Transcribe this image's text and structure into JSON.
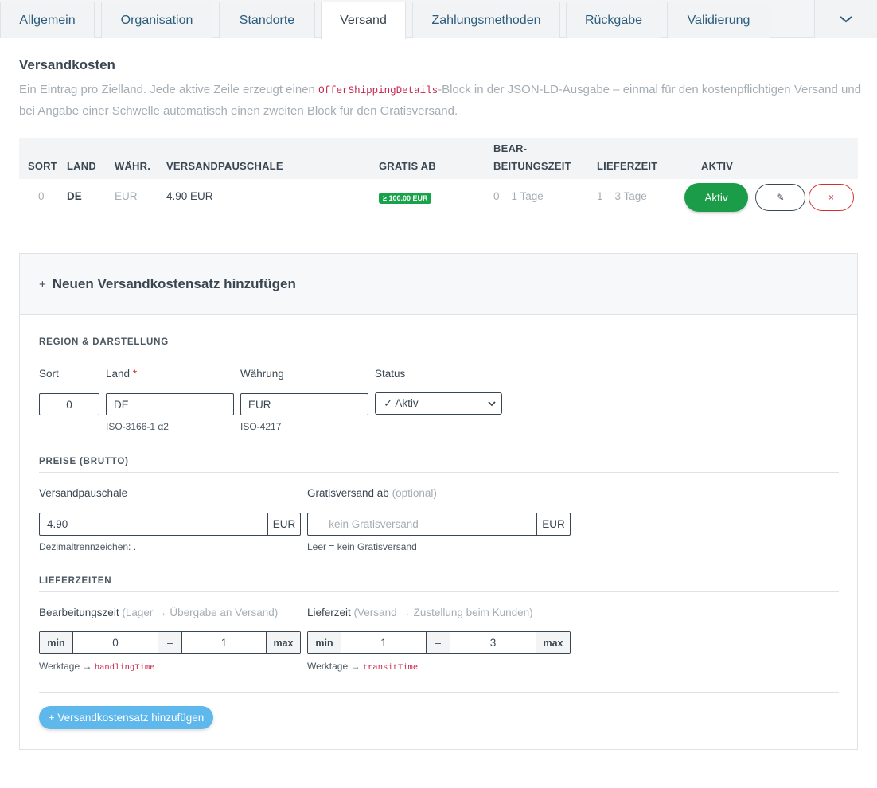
{
  "tabs": [
    {
      "label": "Allgemein"
    },
    {
      "label": "Organisation"
    },
    {
      "label": "Standorte"
    },
    {
      "label": "Versand"
    },
    {
      "label": "Zahlungsmethoden"
    },
    {
      "label": "Rückgabe"
    },
    {
      "label": "Validierung"
    }
  ],
  "active_tab": "Versand",
  "section": {
    "title": "Versandkosten",
    "intro_before": "Ein Eintrag pro Zielland. Jede aktive Zeile erzeugt einen ",
    "intro_code": "OfferShippingDetails",
    "intro_after": "-Block in der JSON-LD-Ausgabe – einmal für den kostenpflichtigen Versand und bei Angabe einer Schwelle automatisch einen zweiten Block für den Gratisversand."
  },
  "table": {
    "headers": {
      "sort": "SORT",
      "land": "LAND",
      "waehr": "WÄHR.",
      "pauschale": "VERSANDPAUSCHALE",
      "gratis": "GRATIS AB",
      "bearbeitung_1": "BEAR-",
      "bearbeitung_2": "BEITUNGSZEIT",
      "lieferzeit": "LIEFERZEIT",
      "aktiv": "AKTIV"
    },
    "rows": [
      {
        "sort": "0",
        "land": "DE",
        "waehrung": "EUR",
        "pauschale": "4.90 EUR",
        "gratis_badge": "≥ 100.00 EUR",
        "bearbeitung": "0 – 1 Tage",
        "lieferzeit": "1 – 3 Tage",
        "aktiv_label": "Aktiv",
        "edit_icon": "✎",
        "delete_icon": "×"
      }
    ]
  },
  "form": {
    "header_plus": "+",
    "header_title": "Neuen Versandkostensatz hinzufügen",
    "region": {
      "title": "REGION & DARSTELLUNG",
      "sort_label": "Sort",
      "sort_value": "0",
      "land_label": "Land",
      "land_required": "*",
      "land_value": "DE",
      "land_help": "ISO-3166-1 α2",
      "waehrung_label": "Währung",
      "waehrung_value": "EUR",
      "waehrung_help": "ISO-4217",
      "status_label": "Status",
      "status_value": "✓ Aktiv"
    },
    "preise": {
      "title": "PREISE (BRUTTO)",
      "pauschale_label": "Versandpauschale",
      "pauschale_value": "4.90",
      "pauschale_unit": "EUR",
      "pauschale_help": "Dezimaltrennzeichen: .",
      "gratis_label": "Gratisversand ab",
      "gratis_optional": "(optional)",
      "gratis_placeholder": "— kein Gratisversand —",
      "gratis_unit": "EUR",
      "gratis_help": "Leer = kein Gratisversand"
    },
    "lieferzeiten": {
      "title": "LIEFERZEITEN",
      "bearbeitung_label": "Bearbeitungszeit",
      "bearbeitung_hint": "(Lager → Übergabe an Versand)",
      "bearbeitung_min_label": "min",
      "bearbeitung_min": "0",
      "bearbeitung_sep": "–",
      "bearbeitung_max": "1",
      "bearbeitung_max_label": "max",
      "bearbeitung_help": "Werktage → ",
      "bearbeitung_help_code": "handlingTime",
      "liefer_label": "Lieferzeit",
      "liefer_hint": "(Versand → Zustellung beim Kunden)",
      "liefer_min_label": "min",
      "liefer_min": "1",
      "liefer_sep": "–",
      "liefer_max": "3",
      "liefer_max_label": "max",
      "liefer_help": "Werktage → ",
      "liefer_help_code": "transitTime"
    },
    "submit_label": "+ Versandkostensatz hinzufügen"
  },
  "colors": {
    "accent": "#2b5d7c",
    "active_green": "#1a9c49",
    "badge_green": "#16a34a",
    "danger": "#d62d2d",
    "submit_blue": "#5fb8ec"
  }
}
